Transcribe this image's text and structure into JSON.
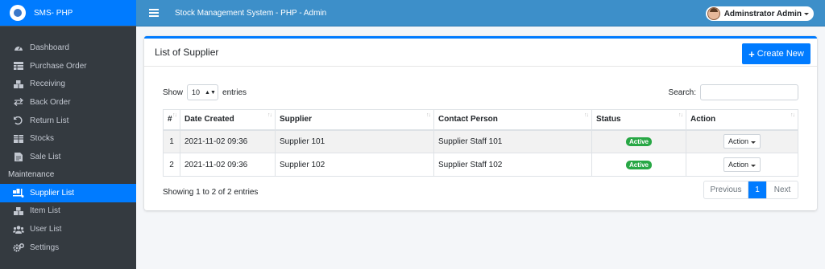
{
  "brand": {
    "name": "SMS- PHP"
  },
  "topbar": {
    "title": "Stock Management System - PHP - Admin",
    "user": "Adminstrator Admin"
  },
  "sidebar": {
    "items": [
      {
        "label": "Dashboard",
        "icon": "dashboard-icon"
      },
      {
        "label": "Purchase Order",
        "icon": "table-icon"
      },
      {
        "label": "Receiving",
        "icon": "boxes-icon"
      },
      {
        "label": "Back Order",
        "icon": "exchange-icon"
      },
      {
        "label": "Return List",
        "icon": "undo-icon"
      },
      {
        "label": "Stocks",
        "icon": "grid-icon"
      },
      {
        "label": "Sale List",
        "icon": "receipt-icon"
      }
    ],
    "section": "Maintenance",
    "maint_items": [
      {
        "label": "Supplier List",
        "icon": "truck-loading-icon",
        "active": true
      },
      {
        "label": "Item List",
        "icon": "boxes-icon"
      },
      {
        "label": "User List",
        "icon": "users-icon"
      },
      {
        "label": "Settings",
        "icon": "cogs-icon"
      }
    ]
  },
  "card": {
    "title": "List of Supplier",
    "create_label": "Create New",
    "show_label": "Show",
    "length_value": "10",
    "entries_label": "entries",
    "search_label": "Search:",
    "info": "Showing 1 to 2 of 2 entries",
    "pager": {
      "prev": "Previous",
      "current": "1",
      "next": "Next"
    }
  },
  "table": {
    "headers": [
      "#",
      "Date Created",
      "Supplier",
      "Contact Person",
      "Status",
      "Action"
    ],
    "rows": [
      {
        "num": "1",
        "date": "2021-11-02 09:36",
        "supplier": "Supplier 101",
        "contact": "Supplier Staff 101",
        "status": "Active",
        "action": "Action"
      },
      {
        "num": "2",
        "date": "2021-11-02 09:36",
        "supplier": "Supplier 102",
        "contact": "Supplier Staff 102",
        "status": "Active",
        "action": "Action"
      }
    ]
  },
  "colors": {
    "primary": "#007bff",
    "sidebar": "#343a40",
    "topbar": "#3d8fc9",
    "success": "#28a745"
  }
}
